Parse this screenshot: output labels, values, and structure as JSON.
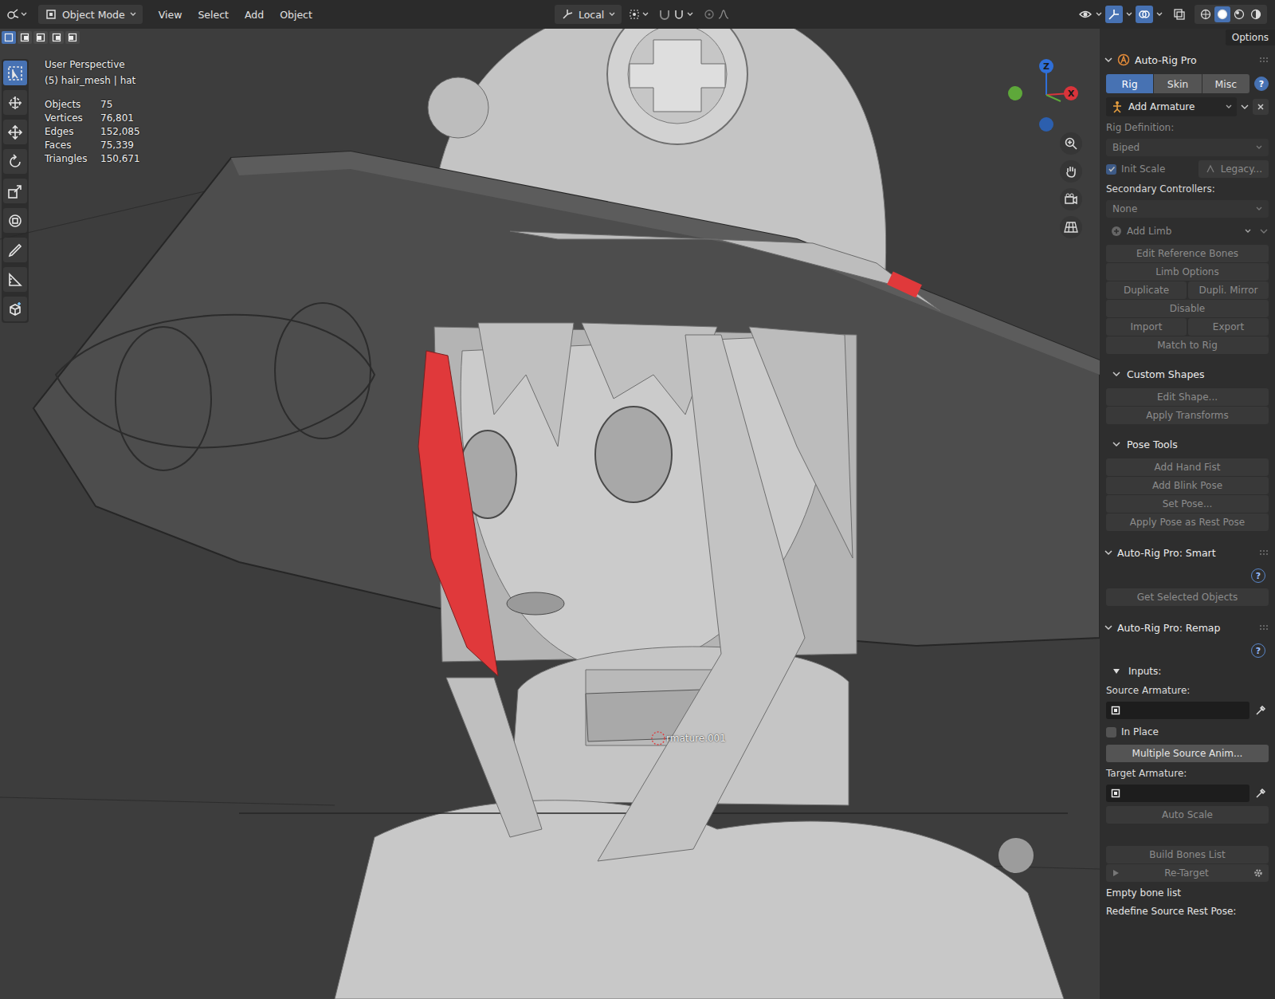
{
  "header": {
    "mode": "Object Mode",
    "menus": [
      "View",
      "Select",
      "Add",
      "Object"
    ],
    "orientation": "Local",
    "options": "Options"
  },
  "shading": [
    {
      "selected": false
    },
    {
      "selected": true
    },
    {
      "selected": false
    },
    {
      "selected": false
    }
  ],
  "select_modes": [
    {
      "selected": true
    },
    {
      "selected": false
    },
    {
      "selected": false
    },
    {
      "selected": false
    },
    {
      "selected": false
    }
  ],
  "toolbar": [
    {
      "kind": "select",
      "selected": true
    },
    {
      "kind": "cursor",
      "selected": false
    },
    {
      "kind": "move",
      "selected": false
    },
    {
      "kind": "rotate",
      "selected": false
    },
    {
      "kind": "scale",
      "selected": false
    },
    {
      "kind": "transform",
      "selected": false
    },
    {
      "kind": "annotate",
      "selected": false
    },
    {
      "kind": "measure",
      "selected": false
    },
    {
      "kind": "add-cube",
      "selected": false
    }
  ],
  "viewport": {
    "view": "User Perspective",
    "context": "(5) hair_mesh | hat",
    "stats": [
      {
        "label": "Objects",
        "value": "75"
      },
      {
        "label": "Vertices",
        "value": "76,801"
      },
      {
        "label": "Edges",
        "value": "152,085"
      },
      {
        "label": "Faces",
        "value": "75,339"
      },
      {
        "label": "Triangles",
        "value": "150,671"
      }
    ],
    "object_label": "rmature.001"
  },
  "gizmo": [
    {
      "label": "Z",
      "color": "#2f6fd8"
    },
    {
      "label": "",
      "color": "#5ea83a"
    },
    {
      "label": "X",
      "color": "#d9343b"
    },
    {
      "label": "",
      "color": "#2c5fae"
    }
  ],
  "panels": [
    {
      "title": "Auto-Rig Pro",
      "expanded": true,
      "rows": [
        {
          "kind": "tabs",
          "items": [
            {
              "label": "Rig",
              "selected": true
            },
            {
              "label": "Skin",
              "selected": false
            },
            {
              "label": "Misc",
              "selected": false
            }
          ],
          "help": "?"
        },
        {
          "kind": "dropdown",
          "label": "Add Armature",
          "disabled": false,
          "closable": true
        },
        {
          "kind": "label",
          "text": "Rig Definition:",
          "disabled": true
        },
        {
          "kind": "field",
          "value": "Biped",
          "disabled": true
        },
        {
          "kind": "check-pair",
          "label": "Init Scale",
          "checked": true,
          "button": "Legacy...",
          "disabled": true
        },
        {
          "kind": "label",
          "text": "Secondary Controllers:",
          "disabled": false
        },
        {
          "kind": "field",
          "value": "None",
          "disabled": true
        },
        {
          "kind": "dropdown",
          "label": "Add Limb",
          "disabled": true,
          "closable": false
        },
        {
          "kind": "button",
          "label": "Edit Reference Bones",
          "disabled": true
        },
        {
          "kind": "button",
          "label": "Limb Options",
          "disabled": true
        },
        {
          "kind": "pair",
          "labels": [
            "Duplicate",
            "Dupli. Mirror"
          ],
          "disabled": true
        },
        {
          "kind": "button",
          "label": "Disable",
          "disabled": true
        },
        {
          "kind": "pair",
          "labels": [
            "Import",
            "Export"
          ],
          "disabled": true
        },
        {
          "kind": "button",
          "label": "Match to Rig",
          "disabled": true
        },
        {
          "kind": "subpanel",
          "title": "Custom Shapes",
          "expanded": true
        },
        {
          "kind": "button",
          "label": "Edit Shape...",
          "disabled": true
        },
        {
          "kind": "button",
          "label": "Apply Transforms",
          "disabled": true
        },
        {
          "kind": "subpanel",
          "title": "Pose Tools",
          "expanded": true
        },
        {
          "kind": "button",
          "label": "Add Hand Fist",
          "disabled": true
        },
        {
          "kind": "button",
          "label": "Add Blink Pose",
          "disabled": true
        },
        {
          "kind": "button",
          "label": "Set Pose...",
          "disabled": true
        },
        {
          "kind": "button",
          "label": "Apply Pose as Rest Pose",
          "disabled": true
        }
      ]
    },
    {
      "title": "Auto-Rig Pro: Smart",
      "expanded": true,
      "rows": [
        {
          "kind": "help",
          "text": "?"
        },
        {
          "kind": "button",
          "label": "Get Selected Objects",
          "disabled": true
        }
      ]
    },
    {
      "title": "Auto-Rig Pro: Remap",
      "expanded": true,
      "rows": [
        {
          "kind": "help",
          "text": "?"
        },
        {
          "kind": "toggle",
          "label": "Inputs:",
          "expanded": true
        },
        {
          "kind": "label",
          "text": "Source Armature:",
          "disabled": false
        },
        {
          "kind": "picker",
          "value": ""
        },
        {
          "kind": "check",
          "label": "In Place",
          "checked": false
        },
        {
          "kind": "button",
          "label": "Multiple Source Anim...",
          "disabled": false
        },
        {
          "kind": "label",
          "text": "Target Armature:",
          "disabled": false
        },
        {
          "kind": "picker",
          "value": ""
        },
        {
          "kind": "button",
          "label": "Auto Scale",
          "disabled": true
        },
        {
          "kind": "text",
          "text": ""
        },
        {
          "kind": "button",
          "label": "Build Bones List",
          "disabled": true
        },
        {
          "kind": "action",
          "label": "Re-Target",
          "disabled": true
        },
        {
          "kind": "text",
          "text": "Empty bone list"
        },
        {
          "kind": "text",
          "text": "Redefine Source Rest Pose:"
        }
      ]
    }
  ]
}
